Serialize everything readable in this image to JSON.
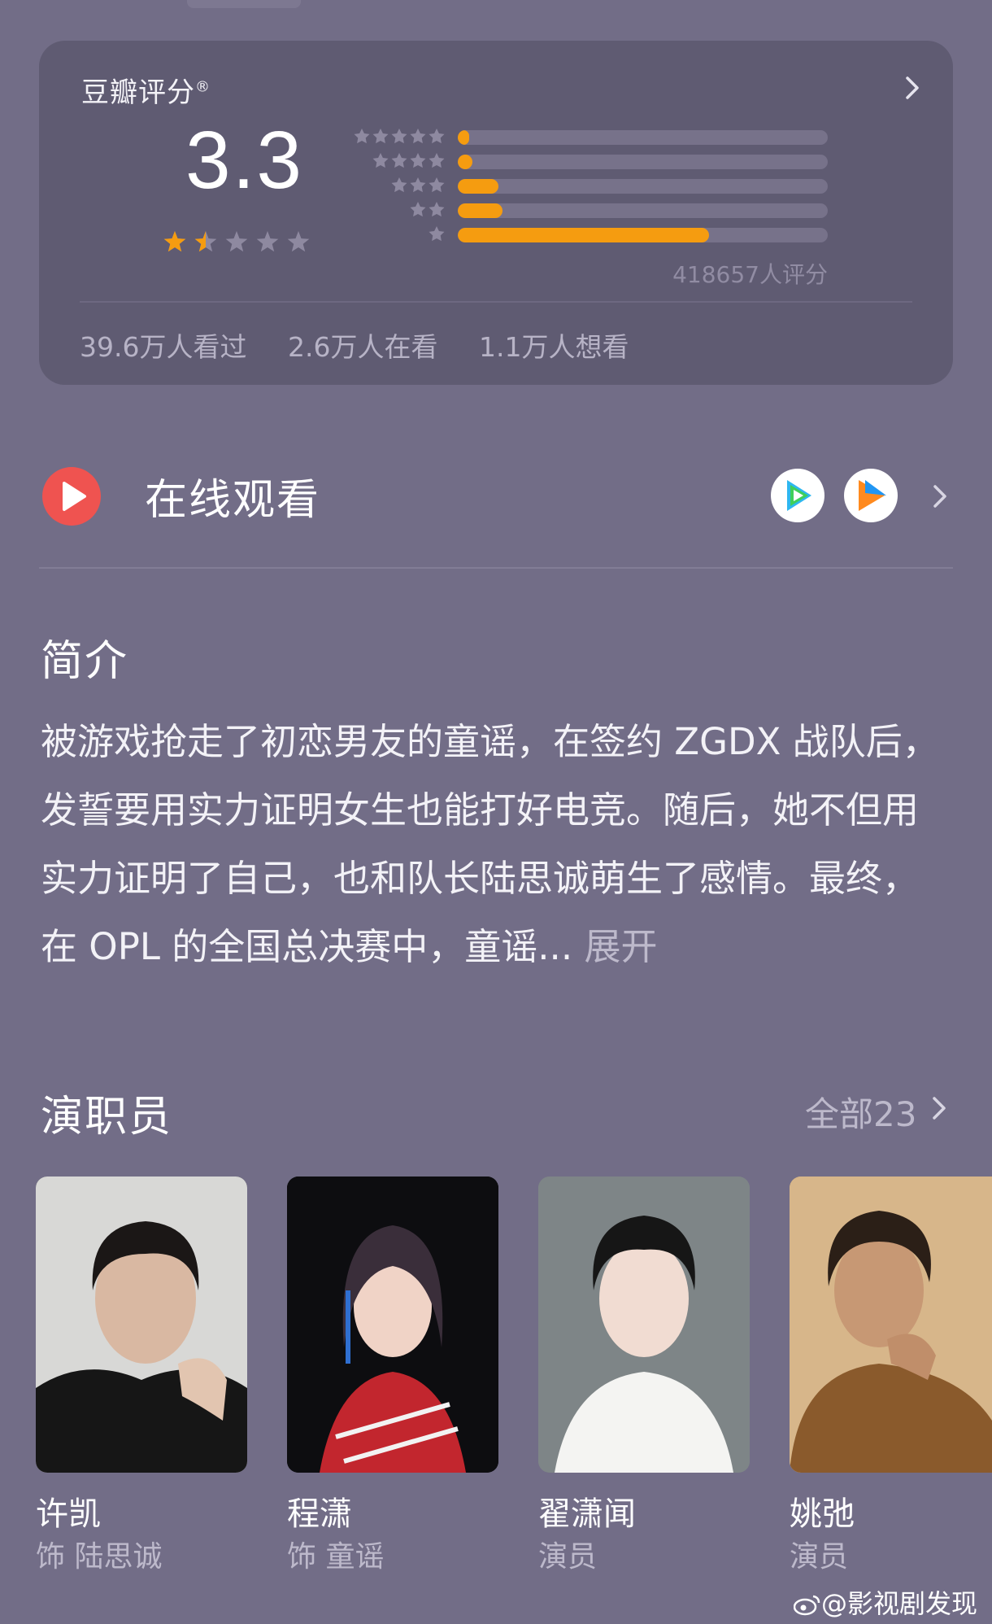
{
  "rating": {
    "title": "豆瓣评分",
    "mark": "®",
    "score": "3.3",
    "stars_filled": 1.5,
    "stars_total": 5,
    "distribution": [
      {
        "stars": 5,
        "percent": 3
      },
      {
        "stars": 4,
        "percent": 4
      },
      {
        "stars": 3,
        "percent": 11
      },
      {
        "stars": 2,
        "percent": 12
      },
      {
        "stars": 1,
        "percent": 68
      }
    ],
    "raters": "418657人评分",
    "stats": [
      "39.6万人看过",
      "2.6万人在看",
      "1.1万人想看"
    ]
  },
  "online": {
    "label": "在线观看",
    "platforms": [
      "tencent-video-icon",
      "youku-icon"
    ]
  },
  "intro": {
    "title": "简介",
    "text": "被游戏抢走了初恋男友的童谣，在签约 ZGDX 战队后，发誓要用实力证明女生也能打好电竞。随后，她不但用实力证明了自己，也和队长陆思诚萌生了感情。最终，在 OPL 的全国总决赛中，童谣...",
    "more": "展开"
  },
  "cast": {
    "title": "演职员",
    "all": "全部23",
    "members": [
      {
        "name": "许凯",
        "role": "饰 陆思诚"
      },
      {
        "name": "程潇",
        "role": "饰 童谣"
      },
      {
        "name": "翟潇闻",
        "role": "演员"
      },
      {
        "name": "姚弛",
        "role": "演员"
      }
    ]
  },
  "watermark": "@影视剧发现",
  "colors": {
    "background": "#726d87",
    "card": "#5f5b72",
    "accent": "#f59c10",
    "play_red": "#ef5350"
  }
}
